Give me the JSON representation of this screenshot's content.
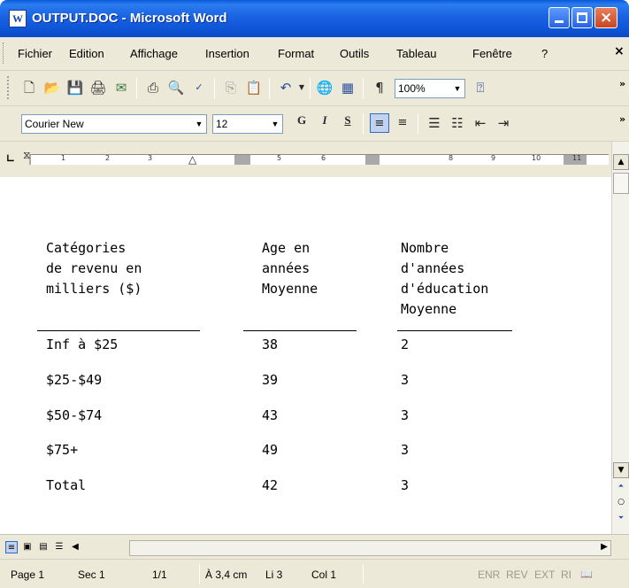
{
  "window": {
    "title": "OUTPUT.DOC - Microsoft Word",
    "app_icon": "W",
    "close_glyph": "×"
  },
  "menu": {
    "items": [
      "Fichier",
      "Edition",
      "Affichage",
      "Insertion",
      "Format",
      "Outils",
      "Tableau",
      "Fenêtre",
      "?"
    ],
    "close": "×"
  },
  "toolbar_standard": {
    "icons": [
      "new-icon",
      "open-icon",
      "save-icon",
      "permission-icon",
      "email-icon",
      "print-icon",
      "print-preview-icon",
      "spelling-icon",
      "copy-icon",
      "paste-icon",
      "undo-icon",
      "hyperlink-icon",
      "table-icon",
      "show-formatting-icon",
      "help-icon"
    ],
    "zoom": "100%",
    "pilcrow": "¶",
    "overflow": "»"
  },
  "toolbar_formatting": {
    "font": "Courier New",
    "size": "12",
    "bold": "G",
    "italic": "I",
    "underline": "S",
    "overflow": "»"
  },
  "ruler": {
    "numbers": [
      "1",
      "2",
      "3",
      "5",
      "6",
      "8",
      "9",
      "10",
      "11"
    ]
  },
  "document": {
    "headers": {
      "col1": [
        "Catégories",
        "de revenu en",
        "milliers ($)"
      ],
      "col2": [
        "Age en",
        "années",
        "Moyenne"
      ],
      "col3": [
        "Nombre",
        "d'années",
        "d'éducation",
        "Moyenne"
      ]
    },
    "rows": [
      {
        "category": "Inf à $25",
        "age": "38",
        "education": "2"
      },
      {
        "category": "$25-$49",
        "age": "39",
        "education": "3"
      },
      {
        "category": "$50-$74",
        "age": "43",
        "education": "3"
      },
      {
        "category": "$75+",
        "age": "49",
        "education": "3"
      },
      {
        "category": "Total",
        "age": "42",
        "education": "3"
      }
    ]
  },
  "status": {
    "page": "Page 1",
    "section": "Sec 1",
    "page_of": "1/1",
    "at": "À 3,4 cm",
    "line": "Li 3",
    "col": "Col 1",
    "rec": "ENR",
    "rev": "REV",
    "ext": "EXT",
    "ovr": "RI"
  }
}
